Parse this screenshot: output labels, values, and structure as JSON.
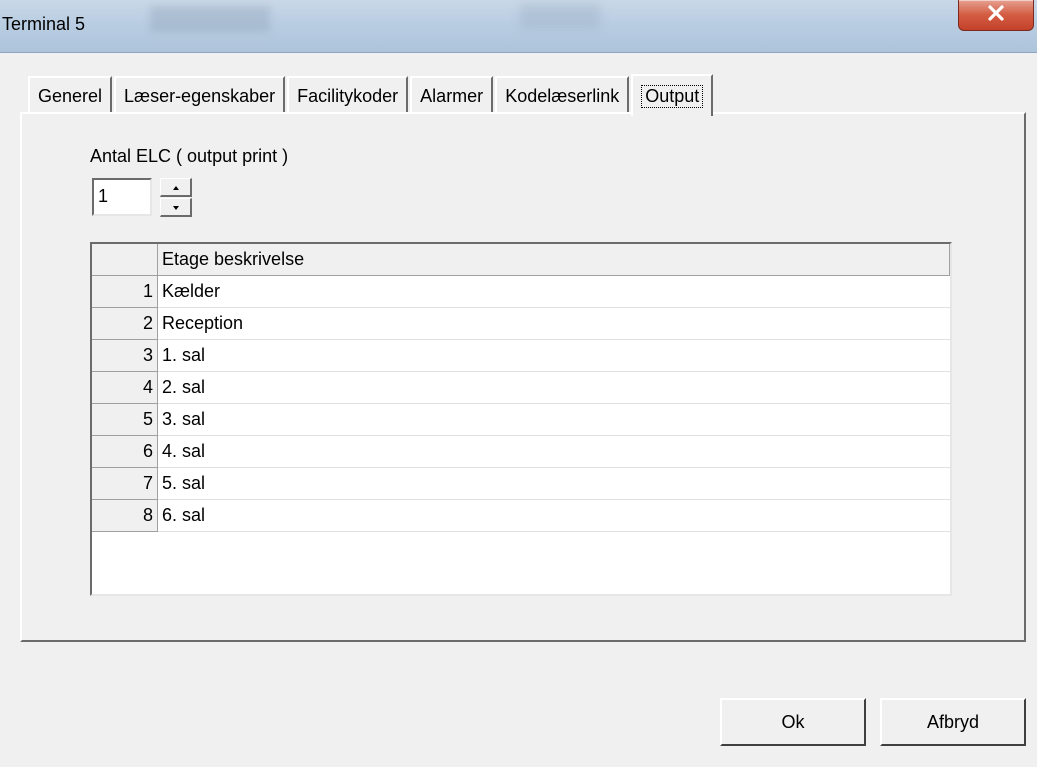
{
  "window": {
    "title": "Terminal 5"
  },
  "tabs": [
    {
      "label": "Generel",
      "active": false
    },
    {
      "label": "Læser-egenskaber",
      "active": false
    },
    {
      "label": "Facilitykoder",
      "active": false
    },
    {
      "label": "Alarmer",
      "active": false
    },
    {
      "label": "Kodelæserlink",
      "active": false
    },
    {
      "label": "Output",
      "active": true
    }
  ],
  "output_panel": {
    "elc_label": "Antal ELC ( output print )",
    "elc_value": "1",
    "grid": {
      "header": {
        "num": "",
        "description": "Etage beskrivelse"
      },
      "rows": [
        {
          "num": "1",
          "description": "Kælder"
        },
        {
          "num": "2",
          "description": "Reception"
        },
        {
          "num": "3",
          "description": "1. sal"
        },
        {
          "num": "4",
          "description": "2. sal"
        },
        {
          "num": "5",
          "description": "3. sal"
        },
        {
          "num": "6",
          "description": "4. sal"
        },
        {
          "num": "7",
          "description": "5. sal"
        },
        {
          "num": "8",
          "description": "6. sal"
        }
      ]
    }
  },
  "buttons": {
    "ok_label": "Ok",
    "cancel_label": "Afbryd"
  },
  "icons": {
    "close": "close-icon",
    "spin_up": "spin-up-icon",
    "spin_down": "spin-down-icon"
  },
  "colors": {
    "close_button": "#c4412a",
    "window_background": "#f0f0f0"
  }
}
